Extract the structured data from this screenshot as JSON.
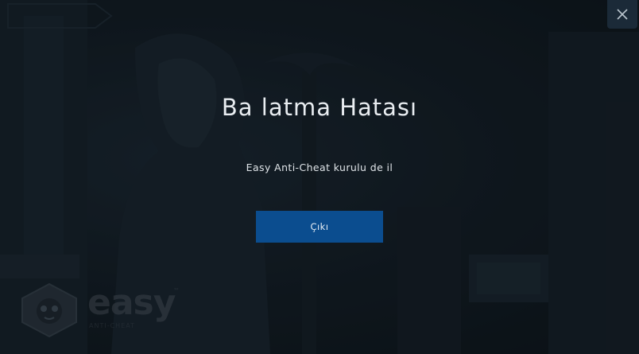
{
  "dialog": {
    "title": "Ba latma Hatası",
    "message": "Easy Anti-Cheat kurulu de il",
    "exit_button_label": "Çıkı"
  },
  "close_button": {
    "icon": "close-icon"
  },
  "branding": {
    "logo_word": "easy",
    "logo_sub": "ANTI-CHEAT",
    "logo_tm": "™"
  },
  "colors": {
    "background": "#131b22",
    "button": "#0b4d8f",
    "close_button_bg": "#1b2a38",
    "text": "#e9edf1"
  }
}
